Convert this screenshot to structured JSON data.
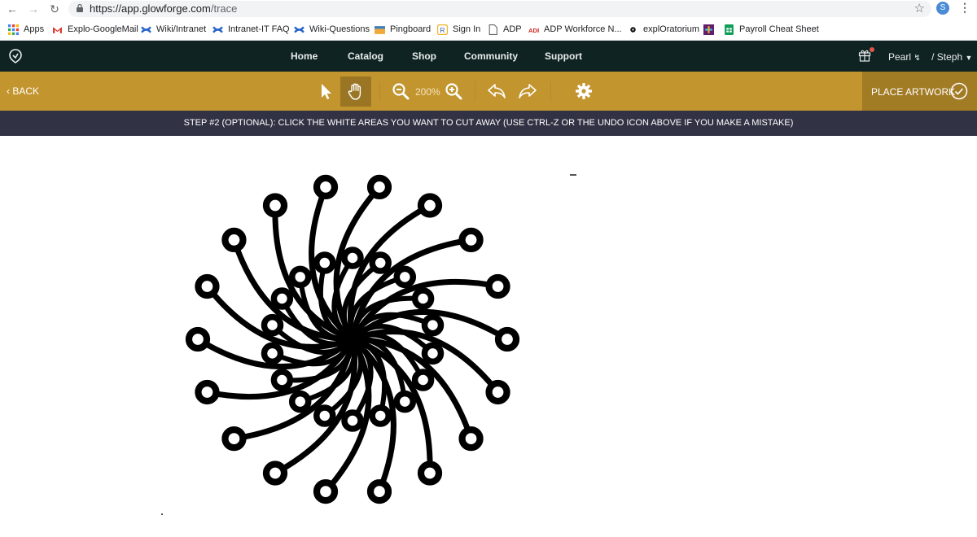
{
  "browser": {
    "url_main": "https://app.glowforge.com",
    "url_path": "/trace",
    "profile_initial": "S"
  },
  "bookmarks": [
    {
      "label": "Apps",
      "icon": "apps-grid-icon",
      "color": "#4285f4"
    },
    {
      "label": "Explo-GoogleMail",
      "icon": "gmail-icon",
      "color": "#d93025"
    },
    {
      "label": "Wiki/Intranet",
      "icon": "confluence-icon",
      "color": "#2563c9"
    },
    {
      "label": "Intranet-IT FAQ",
      "icon": "confluence-icon",
      "color": "#2563c9"
    },
    {
      "label": "Wiki-Questions",
      "icon": "confluence-icon",
      "color": "#2563c9"
    },
    {
      "label": "Pingboard",
      "icon": "pingboard-icon",
      "color": "#f2a93b"
    },
    {
      "label": "Sign In",
      "icon": "signin-icon",
      "color": "#f0b429"
    },
    {
      "label": "ADP",
      "icon": "page-icon",
      "color": "#5f6368"
    },
    {
      "label": "ADP Workforce N...",
      "icon": "adp-icon",
      "color": "#d0271d"
    },
    {
      "label": "explOratorium",
      "icon": "exploratorium-icon",
      "color": "#111111"
    },
    {
      "label": "",
      "icon": "slack-icon",
      "color": "#611f69"
    },
    {
      "label": "Payroll Cheat Sheet",
      "icon": "sheets-icon",
      "color": "#0f9d58"
    }
  ],
  "nav": {
    "links": [
      "Home",
      "Catalog",
      "Shop",
      "Community",
      "Support"
    ],
    "printer": "Pearl",
    "user": "/ Steph"
  },
  "toolbar": {
    "back_label": "BACK",
    "zoom_level": "200%",
    "place_label": "PLACE ARTWORK",
    "active_tool": "hand"
  },
  "step": {
    "text": "STEP #2 (OPTIONAL): CLICK THE WHITE AREAS YOU WANT TO CUT AWAY (USE CTRL-Z OR THE UNDO ICON ABOVE IF YOU MAKE A MISTAKE)"
  },
  "colors": {
    "nav_bg": "#0f2322",
    "toolbar_bg": "#c3952f",
    "place_bg": "#a27b25",
    "stepbar_bg": "#323245"
  }
}
